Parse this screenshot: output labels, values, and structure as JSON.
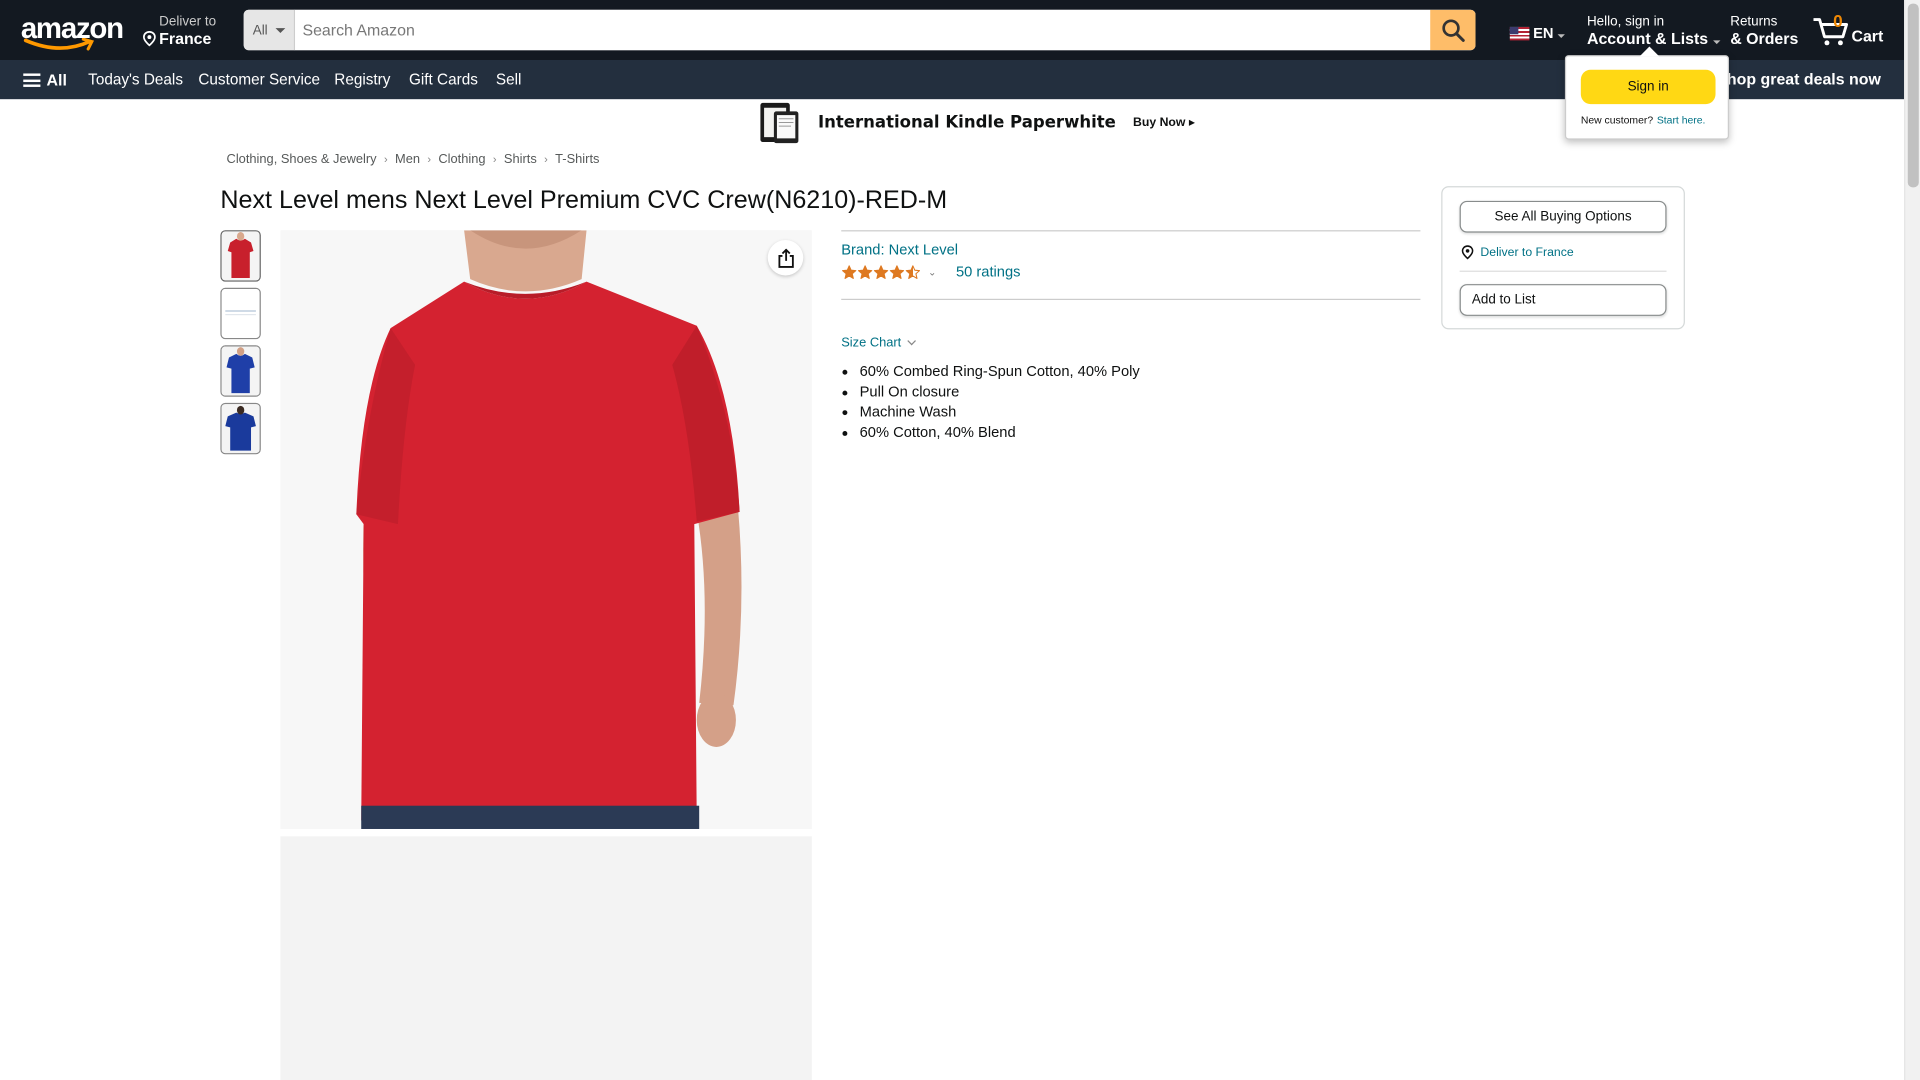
{
  "header": {
    "logo_text": "amazon",
    "deliver_line1": "Deliver to",
    "deliver_line2": "France",
    "search_category": "All",
    "search_placeholder": "Search Amazon",
    "language": "EN",
    "account_line1": "Hello, sign in",
    "account_line2": "Account & Lists",
    "returns_line1": "Returns",
    "returns_line2": "& Orders",
    "cart_count": "0",
    "cart_label": "Cart"
  },
  "nav": {
    "all_label": "All",
    "links": [
      "Today's Deals",
      "Customer Service",
      "Registry",
      "Gift Cards",
      "Sell"
    ],
    "promo": "Shop great deals now"
  },
  "flyout": {
    "signin_label": "Sign in",
    "new_customer": "New customer?",
    "start_here": "Start here."
  },
  "banner": {
    "title": "International Kindle Paperwhite",
    "cta": "Buy Now"
  },
  "breadcrumb": [
    "Clothing, Shoes & Jewelry",
    "Men",
    "Clothing",
    "Shirts",
    "T-Shirts"
  ],
  "product": {
    "title": "Next Level mens Next Level Premium CVC Crew(N6210)-RED-M",
    "brand": "Brand: Next Level",
    "rating": 4.5,
    "ratings_count": "50 ratings",
    "size_chart": "Size Chart",
    "bullets": [
      "60% Combed Ring-Spun Cotton, 40% Poly",
      "Pull On closure",
      "Machine Wash",
      "60% Cotton, 40% Blend"
    ],
    "thumbnail_colors": [
      "#c8202c",
      "#f2f2f2",
      "#1f3fa8",
      "#1a3a9c"
    ],
    "shirt_color": "#d42230"
  },
  "buybox": {
    "see_all": "See All Buying Options",
    "deliver": "Deliver to France",
    "add_to_list": "Add to List"
  },
  "colors": {
    "nav_dark": "#131921",
    "nav_sub": "#232f3e",
    "search_button": "#febd69",
    "signin_yellow": "#ffd814",
    "link": "#007185",
    "star": "#de7921"
  }
}
